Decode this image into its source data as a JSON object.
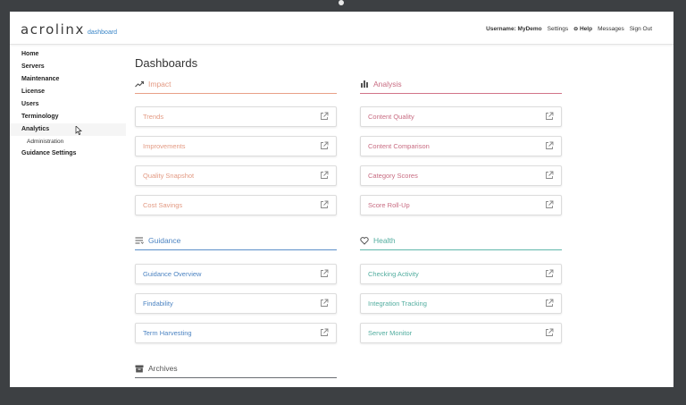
{
  "app": {
    "logo_text": "acrolinx",
    "logo_sub": "dashboard"
  },
  "header": {
    "username": "Username: MyDemo",
    "settings": "Settings",
    "help": "Help",
    "messages": "Messages",
    "signout": "Sign Out"
  },
  "sidebar": {
    "items": [
      "Home",
      "Servers",
      "Maintenance",
      "License",
      "Users",
      "Terminology",
      "Analytics"
    ],
    "sub_item": "Administration",
    "last_item": "Guidance Settings"
  },
  "page_title": "Dashboards",
  "sections": {
    "impact": {
      "title": "Impact",
      "color": "#e8a088",
      "cards": [
        "Trends",
        "Improvements",
        "Quality Snapshot",
        "Cost Savings"
      ]
    },
    "analysis": {
      "title": "Analysis",
      "color": "#d27489",
      "cards": [
        "Content Quality",
        "Content Comparison",
        "Category Scores",
        "Score Roll-Up"
      ]
    },
    "guidance": {
      "title": "Guidance",
      "color": "#5b8fc9",
      "cards": [
        "Guidance Overview",
        "Findability",
        "Term Harvesting"
      ]
    },
    "health": {
      "title": "Health",
      "color": "#5fb7ab",
      "cards": [
        "Checking Activity",
        "Integration Tracking",
        "Server Monitor"
      ]
    },
    "archives": {
      "title": "Archives",
      "color": "#6a6d72"
    }
  },
  "icons": {
    "impact": "trend-up-icon",
    "analysis": "bar-chart-icon",
    "guidance": "list-icon",
    "health": "heart-icon",
    "archives": "archive-icon",
    "card": "external-link-icon"
  }
}
